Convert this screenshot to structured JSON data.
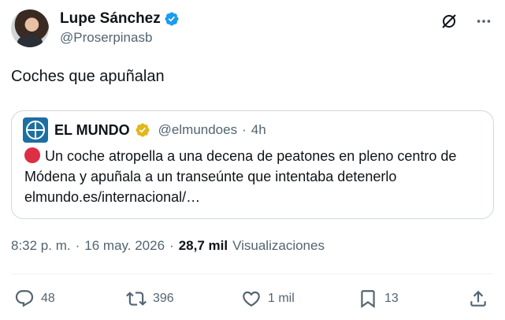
{
  "author": {
    "name": "Lupe Sánchez",
    "handle": "@Proserpinasb"
  },
  "tweet": {
    "text": "Coches que apuñalan"
  },
  "quoted": {
    "name": "EL MUNDO",
    "handle": "@elmundoes",
    "separator": "·",
    "time": "4h",
    "text": "Un coche atropella a una decena de peatones en pleno centro de Módena y apuñala a un transeúnte que intentaba detenerlo  elmundo.es/internacional/…"
  },
  "meta": {
    "time": "8:32 p. m.",
    "dot1": "·",
    "date": "16 may. 2026",
    "dot2": "·",
    "views_count": "28,7 mil",
    "views_label": "Visualizaciones"
  },
  "actions": {
    "replies": "48",
    "reposts": "396",
    "likes": "1 mil",
    "bookmarks": "13"
  },
  "icons": {
    "verified": "verified-badge-icon",
    "gold_verified": "gold-verified-badge-icon",
    "grok": "grok-icon",
    "more": "more-icon",
    "reply": "reply-icon",
    "repost": "repost-icon",
    "like": "like-icon",
    "bookmark": "bookmark-icon",
    "share": "share-icon"
  },
  "colors": {
    "verified_blue": "#1d9bf0",
    "gold": "#e2b719",
    "secondary_text": "#536471",
    "red_circle": "#dd2e44"
  }
}
